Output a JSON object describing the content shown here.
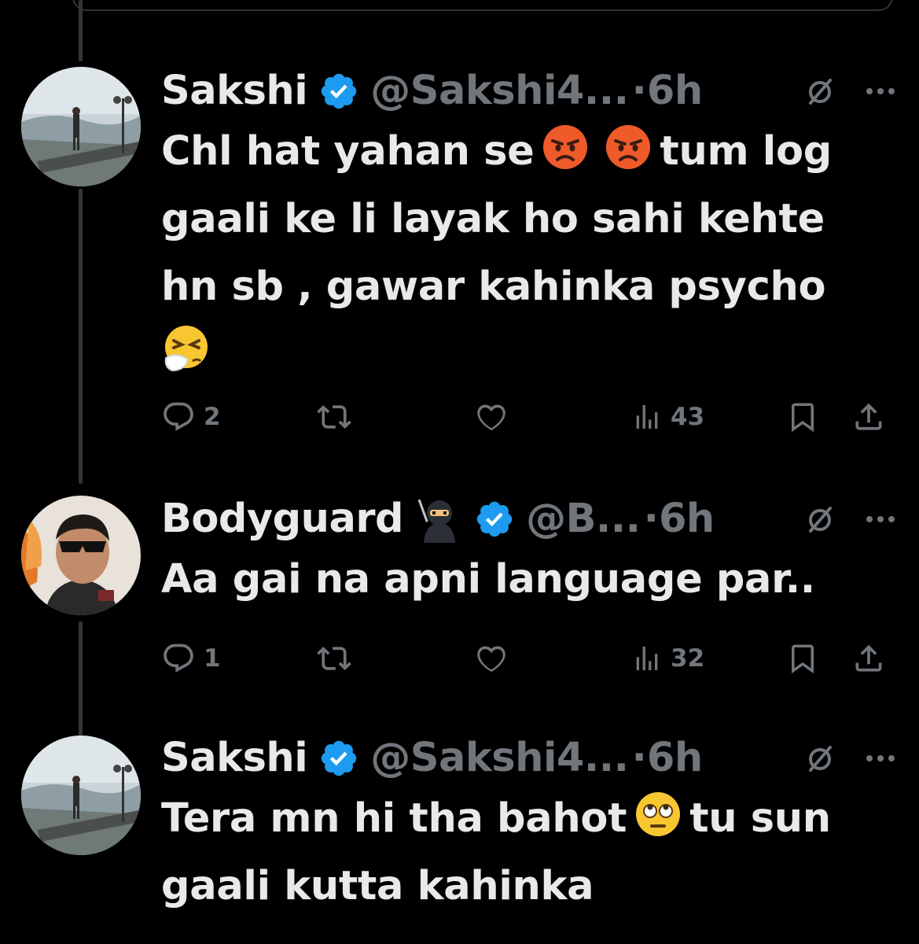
{
  "colors": {
    "background": "#000000",
    "text": "#e7e9ea",
    "secondary": "#71767b",
    "verified_blue": "#1d9bf0",
    "thread_line": "#333639"
  },
  "tweets": [
    {
      "author": "Sakshi",
      "verified": true,
      "handle": "@Sakshi4...",
      "time": "6h",
      "text_lines": [
        "Chl hat yahan se",
        "tum log",
        "gaali ke li layak ho sahi kehte",
        "hn sb , gawar kahinka psycho"
      ],
      "emojis": [
        "pouting-face",
        "pouting-face",
        "sneezing-face"
      ],
      "replies": "2",
      "views": "43",
      "avatar": "lakeside-woman-photo"
    },
    {
      "author": "Bodyguard",
      "verified": true,
      "handle": "@B...",
      "time": "6h",
      "text_lines": [
        "Aa gai na apni language par.."
      ],
      "emojis": [
        "ninja"
      ],
      "replies": "1",
      "views": "32",
      "avatar": "man-in-sunglasses-photo"
    },
    {
      "author": "Sakshi",
      "verified": true,
      "handle": "@Sakshi4...",
      "time": "6h",
      "text_lines": [
        "Tera mn hi tha bahot",
        "tu sun",
        "gaali kutta kahinka"
      ],
      "emojis": [
        "face-with-rolling-eyes"
      ],
      "avatar": "lakeside-woman-photo"
    }
  ],
  "separator_dot": "·"
}
